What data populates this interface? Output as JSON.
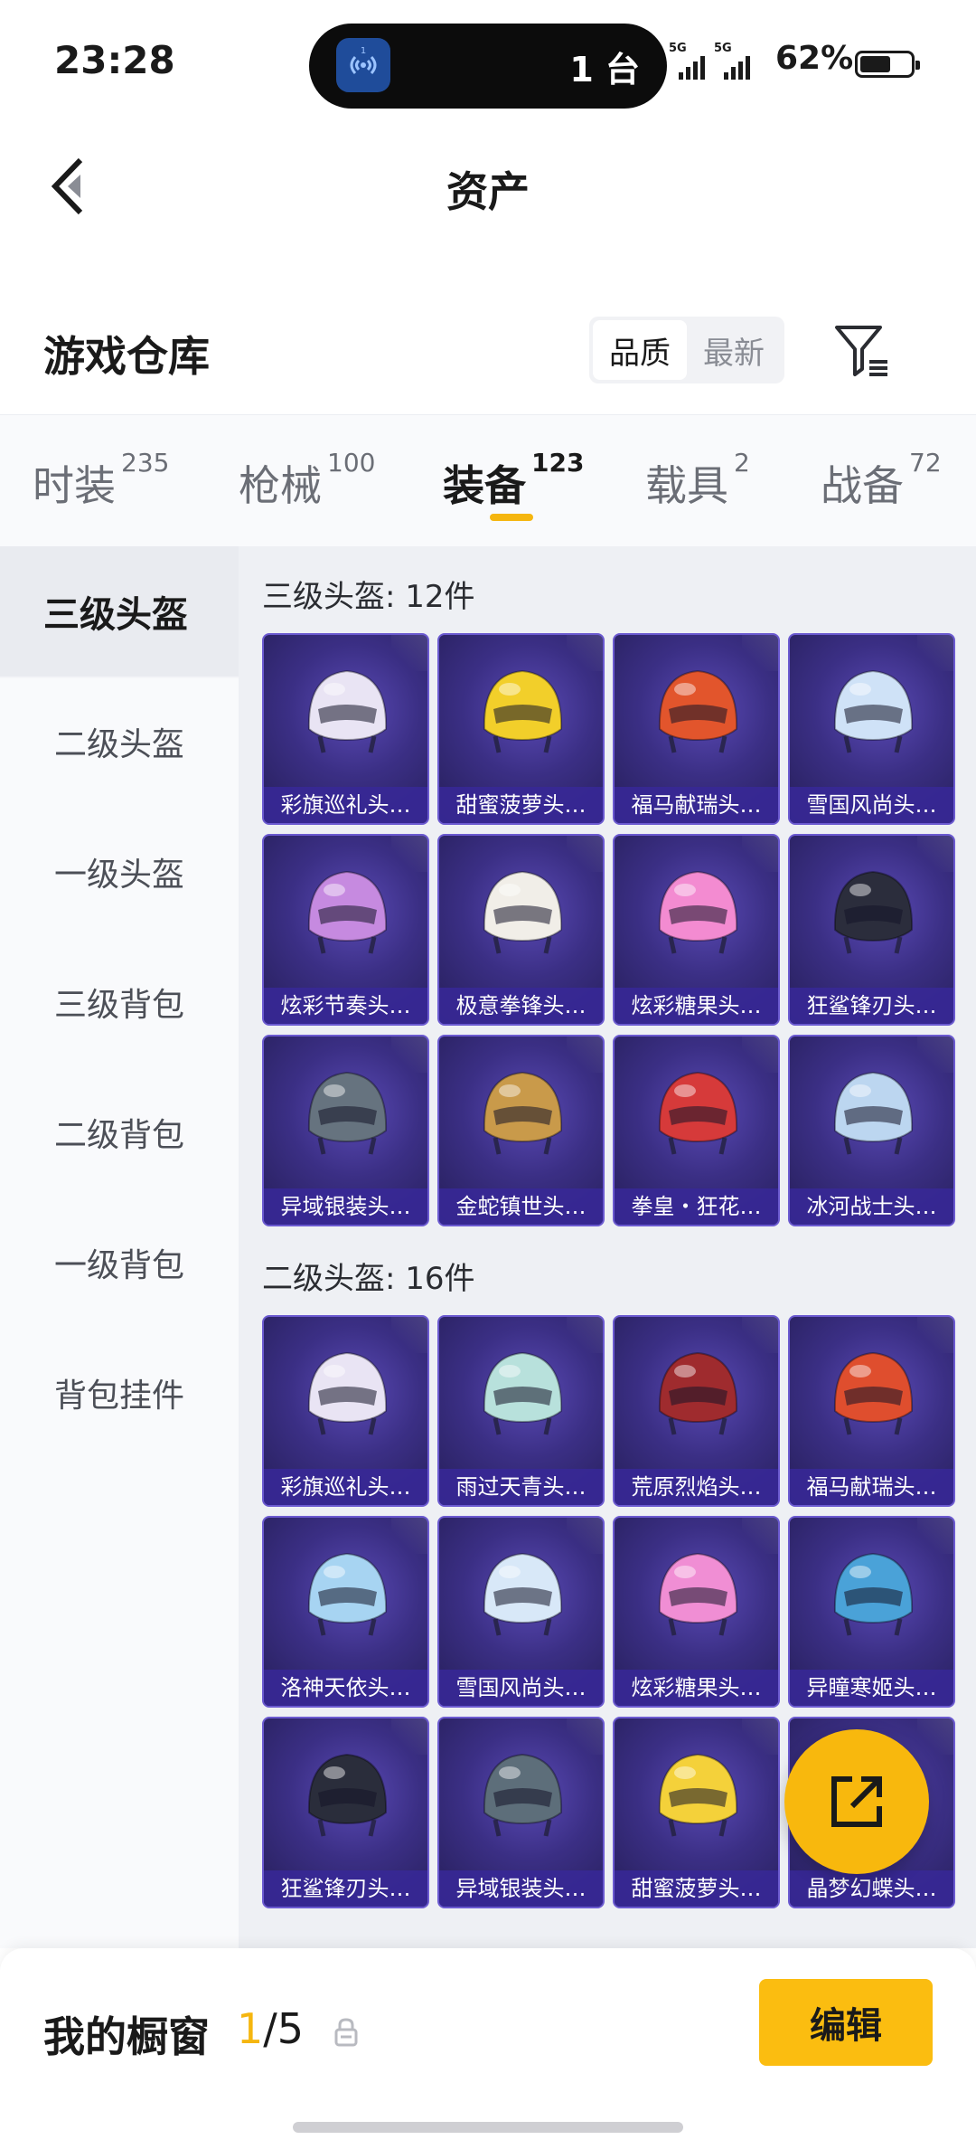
{
  "status": {
    "time": "23:28",
    "island_text": "1 台",
    "island_badge": "1",
    "signal_labels": [
      "5G",
      "5G"
    ],
    "battery": "62%",
    "battery_level": 0.62
  },
  "nav": {
    "title": "资产",
    "back_icon": "chevron-left-icon"
  },
  "warehouse": {
    "title": "游戏仓库",
    "sort_options": [
      "品质",
      "最新"
    ],
    "active_sort": "品质",
    "filter_icon": "filter-icon"
  },
  "tabs": [
    {
      "label": "时装",
      "count": "235"
    },
    {
      "label": "枪械",
      "count": "100"
    },
    {
      "label": "装备",
      "count": "123",
      "active": true
    },
    {
      "label": "载具",
      "count": "2"
    },
    {
      "label": "战备",
      "count": "72"
    }
  ],
  "sidebar": {
    "items": [
      "三级头盔",
      "二级头盔",
      "一级头盔",
      "三级背包",
      "二级背包",
      "一级背包",
      "背包挂件"
    ],
    "active": "三级头盔"
  },
  "groups": [
    {
      "title": "三级头盔: 12件",
      "items": [
        {
          "name": "彩旗巡礼头…",
          "color": "#e9e4f4"
        },
        {
          "name": "甜蜜菠萝头…",
          "color": "#f2cf2a"
        },
        {
          "name": "福马献瑞头…",
          "color": "#e2552c"
        },
        {
          "name": "雪国风尚头…",
          "color": "#cfe2f7"
        },
        {
          "name": "炫彩节奏头…",
          "color": "#c68ae0"
        },
        {
          "name": "极意拳锋头…",
          "color": "#f1eee8"
        },
        {
          "name": "炫彩糖果头…",
          "color": "#f38bd1"
        },
        {
          "name": "狂鲨锋刃头…",
          "color": "#2b2d3c"
        },
        {
          "name": "异域银装头…",
          "color": "#66737f"
        },
        {
          "name": "金蛇镇世头…",
          "color": "#c99a4a"
        },
        {
          "name": "拳皇・狂花…",
          "color": "#d63a3a"
        },
        {
          "name": "冰河战士头…",
          "color": "#bcd6f0"
        }
      ]
    },
    {
      "title": "二级头盔: 16件",
      "items": [
        {
          "name": "彩旗巡礼头…",
          "color": "#e9e4f4"
        },
        {
          "name": "雨过天青头…",
          "color": "#b8e1dc"
        },
        {
          "name": "荒原烈焰头…",
          "color": "#9f2b2e"
        },
        {
          "name": "福马献瑞头…",
          "color": "#df4e2e"
        },
        {
          "name": "洛神天依头…",
          "color": "#a7d4f2"
        },
        {
          "name": "雪国风尚头…",
          "color": "#d8e8f8"
        },
        {
          "name": "炫彩糖果头…",
          "color": "#f08ed4"
        },
        {
          "name": "异瞳寒姬头…",
          "color": "#4aa2d8"
        },
        {
          "name": "狂鲨锋刃头…",
          "color": "#2a2d3b"
        },
        {
          "name": "异域银装头…",
          "color": "#5d6e7a"
        },
        {
          "name": "甜蜜菠萝头…",
          "color": "#f4d13a"
        },
        {
          "name": "晶梦幻蝶头…",
          "color": "#7fb0e8"
        }
      ]
    }
  ],
  "fab": {
    "icon": "share-external-icon"
  },
  "showcase": {
    "label": "我的橱窗",
    "current": "1",
    "total": "/5",
    "lock_icon": "lock-icon",
    "edit_label": "编辑"
  },
  "colors": {
    "accent": "#fbbd10",
    "card_bg": "#3b2f85"
  }
}
